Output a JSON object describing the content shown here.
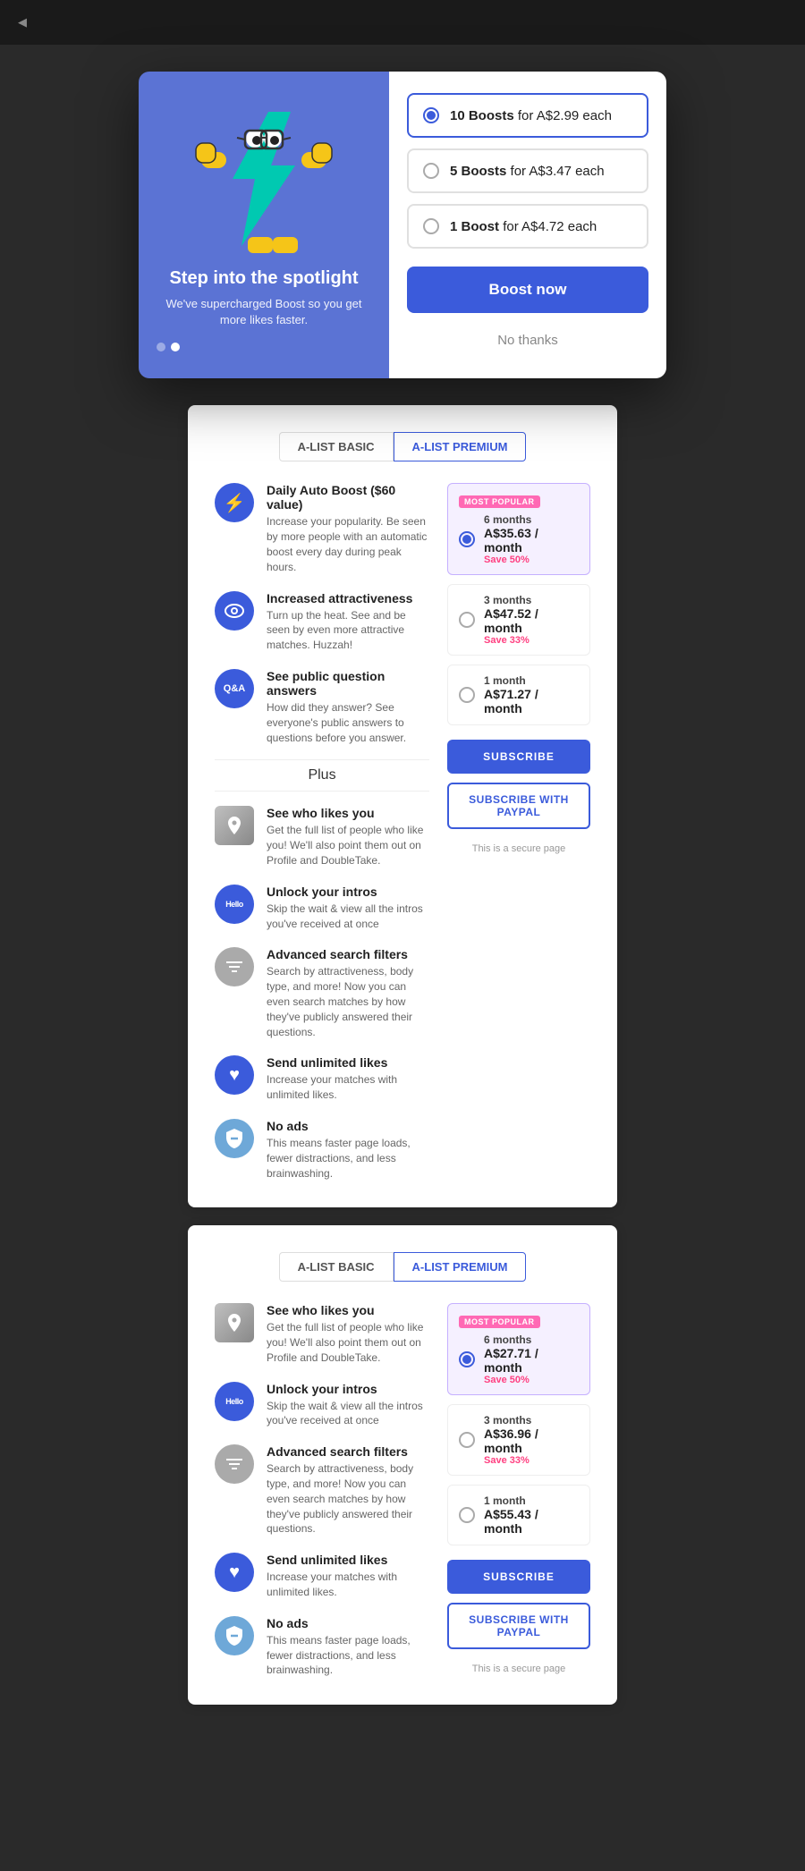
{
  "modal": {
    "left": {
      "title": "Step into the spotlight",
      "subtitle": "We've supercharged Boost so you get more likes faster."
    },
    "options": [
      {
        "id": "opt1",
        "count": "10 Boosts",
        "price": "for A$2.99 each",
        "selected": true
      },
      {
        "id": "opt2",
        "count": "5 Boosts",
        "price": "for A$3.47 each",
        "selected": false
      },
      {
        "id": "opt3",
        "count": "1 Boost",
        "price": "for A$4.72 each",
        "selected": false
      }
    ],
    "boost_button": "Boost now",
    "no_thanks": "No thanks"
  },
  "panel1": {
    "tabs": [
      {
        "label": "A-LIST BASIC",
        "active": false
      },
      {
        "label": "A-LIST PREMIUM",
        "active": true
      }
    ],
    "features": [
      {
        "icon": "⚡",
        "iconClass": "blue",
        "title": "Daily Auto Boost ($60 value)",
        "desc": "Increase your popularity. Be seen by more people with an automatic boost every day during peak hours."
      },
      {
        "icon": "👁",
        "iconClass": "eye",
        "title": "Increased attractiveness",
        "desc": "Turn up the heat. See and be seen by even more attractive matches. Huzzah!"
      },
      {
        "icon": "Q&A",
        "iconClass": "qa",
        "title": "See public question answers",
        "desc": "How did they answer? See everyone's public answers to questions before you answer."
      }
    ],
    "plus_label": "Plus",
    "plus_features": [
      {
        "icon": "📷",
        "iconClass": "photo",
        "title": "See who likes you",
        "desc": "Get the full list of people who like you! We'll also point them out on Profile and DoubleTake."
      },
      {
        "icon": "Hello",
        "iconClass": "hello",
        "title": "Unlock your intros",
        "desc": "Skip the wait & view all the intros you've received at once"
      },
      {
        "icon": "⚙",
        "iconClass": "filter",
        "title": "Advanced search filters",
        "desc": "Search by attractiveness, body type, and more! Now you can even search matches by how they've publicly answered their questions."
      },
      {
        "icon": "♥",
        "iconClass": "heart",
        "title": "Send unlimited likes",
        "desc": "Increase your matches with unlimited likes."
      },
      {
        "icon": "🚫",
        "iconClass": "shield",
        "title": "No ads",
        "desc": "This means faster page loads, fewer distractions, and less brainwashing."
      }
    ],
    "pricing": [
      {
        "popular": true,
        "badge": "MOST POPULAR",
        "duration": "6 months",
        "amount": "A$35.63 / month",
        "save": "Save 50%",
        "selected": true
      },
      {
        "popular": false,
        "duration": "3 months",
        "amount": "A$47.52 / month",
        "save": "Save 33%",
        "selected": false
      },
      {
        "popular": false,
        "duration": "1 month",
        "amount": "A$71.27 / month",
        "save": "",
        "selected": false
      }
    ],
    "subscribe_button": "SUBSCRIBE",
    "subscribe_paypal": "SUBSCRIBE WITH PAYPAL",
    "secure_text": "This is a secure page"
  },
  "panel2": {
    "tabs": [
      {
        "label": "A-LIST BASIC",
        "active": false
      },
      {
        "label": "A-LIST PREMIUM",
        "active": true
      }
    ],
    "features": [
      {
        "icon": "📷",
        "iconClass": "photo",
        "title": "See who likes you",
        "desc": "Get the full list of people who like you! We'll also point them out on Profile and DoubleTake."
      },
      {
        "icon": "Hello",
        "iconClass": "hello",
        "title": "Unlock your intros",
        "desc": "Skip the wait & view all the intros you've received at once"
      },
      {
        "icon": "⚙",
        "iconClass": "filter",
        "title": "Advanced search filters",
        "desc": "Search by attractiveness, body type, and more! Now you can even search matches by how they've publicly answered their questions."
      },
      {
        "icon": "♥",
        "iconClass": "heart",
        "title": "Send unlimited likes",
        "desc": "Increase your matches with unlimited likes."
      },
      {
        "icon": "🚫",
        "iconClass": "shield",
        "title": "No ads",
        "desc": "This means faster page loads, fewer distractions, and less brainwashing."
      }
    ],
    "pricing": [
      {
        "popular": true,
        "badge": "MOST POPULAR",
        "duration": "6 months",
        "amount": "A$27.71 / month",
        "save": "Save 50%",
        "selected": true
      },
      {
        "popular": false,
        "duration": "3 months",
        "amount": "A$36.96 / month",
        "save": "Save 33%",
        "selected": false
      },
      {
        "popular": false,
        "duration": "1 month",
        "amount": "A$55.43 / month",
        "save": "",
        "selected": false
      }
    ],
    "subscribe_button": "SUBSCRIBE",
    "subscribe_paypal": "SUBSCRIBE WITH PAYPAL",
    "secure_text": "This is a secure page"
  }
}
